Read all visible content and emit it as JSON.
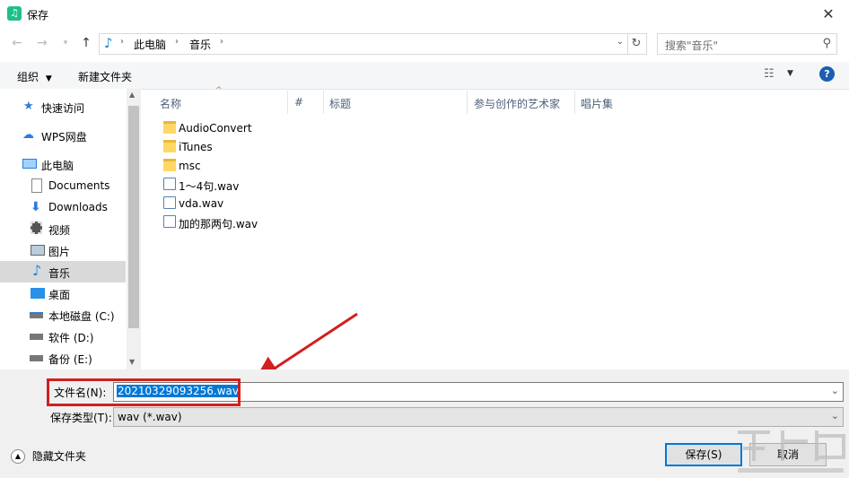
{
  "window": {
    "title": "保存"
  },
  "address": {
    "crumbs": [
      "此电脑",
      "音乐"
    ]
  },
  "search": {
    "placeholder": "搜索\"音乐\""
  },
  "toolbar": {
    "organize": "组织",
    "new_folder": "新建文件夹"
  },
  "nav": {
    "items": [
      {
        "label": "快速访问",
        "icon": "star-icon"
      },
      {
        "label": "WPS网盘",
        "icon": "cloud-icon"
      },
      {
        "label": "此电脑",
        "icon": "computer-icon"
      },
      {
        "label": "Documents",
        "icon": "document-icon"
      },
      {
        "label": "Downloads",
        "icon": "download-icon"
      },
      {
        "label": "视频",
        "icon": "video-icon"
      },
      {
        "label": "图片",
        "icon": "picture-icon"
      },
      {
        "label": "音乐",
        "icon": "music-icon"
      },
      {
        "label": "桌面",
        "icon": "desktop-icon"
      },
      {
        "label": "本地磁盘 (C:)",
        "icon": "drive-icon"
      },
      {
        "label": "软件 (D:)",
        "icon": "drive-icon"
      },
      {
        "label": "备份 (E:)",
        "icon": "drive-icon"
      }
    ],
    "selected": "音乐"
  },
  "columns": {
    "name": "名称",
    "number": "#",
    "title": "标题",
    "artists": "参与创作的艺术家",
    "album": "唱片集"
  },
  "files": [
    {
      "name": "AudioConvert",
      "type": "folder"
    },
    {
      "name": "iTunes",
      "type": "folder"
    },
    {
      "name": "msc",
      "type": "folder"
    },
    {
      "name": "1～4句.wav",
      "type": "wav"
    },
    {
      "name": "vda.wav",
      "type": "wav"
    },
    {
      "name": "加的那两句.wav",
      "type": "wav"
    }
  ],
  "form": {
    "filename_label": "文件名(N):",
    "filename_value": "20210329093256.wav",
    "filetype_label": "保存类型(T):",
    "filetype_value": "wav (*.wav)"
  },
  "footer": {
    "hide_folders": "隐藏文件夹",
    "save": "保存(S)",
    "cancel": "取消"
  },
  "colors": {
    "accent": "#0078d7",
    "highlight": "#d21f1f",
    "selected_nav": "#d9d9d9"
  }
}
